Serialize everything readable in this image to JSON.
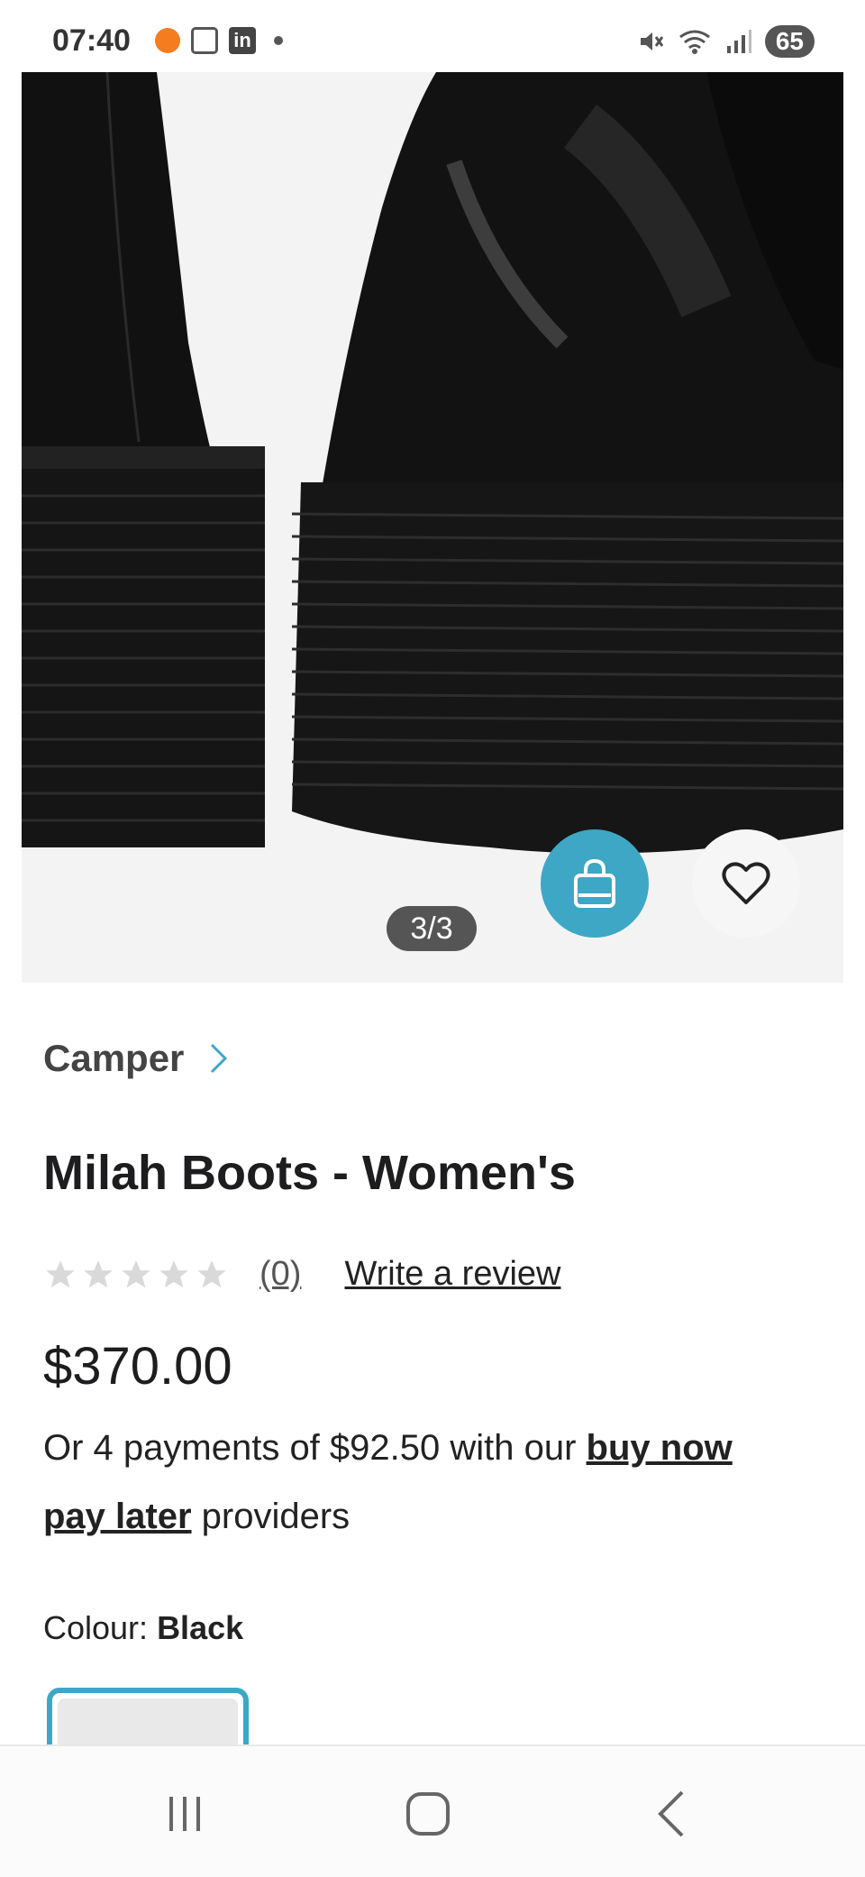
{
  "status_bar": {
    "time": "07:40",
    "battery": "65",
    "icons": [
      "notification-orange-icon",
      "screenshot-icon",
      "linkedin-icon",
      "dot-icon",
      "mute-icon",
      "wifi-icon",
      "signal-icon"
    ]
  },
  "gallery": {
    "counter": "3/3",
    "bag_icon": "shopping-bag-icon",
    "wishlist_icon": "heart-icon"
  },
  "product": {
    "brand": "Camper",
    "title": "Milah Boots - Women's",
    "rating_count": "(0)",
    "write_review": "Write a review",
    "price": "$370.00",
    "bnpl_prefix": "Or 4 payments of $92.50 with our ",
    "bnpl_link": "buy now pay later",
    "bnpl_suffix": " providers",
    "colour_label": "Colour: ",
    "colour_value": "Black"
  },
  "colors": {
    "accent": "#3ea7c6",
    "text": "#1d1d1f",
    "star_empty": "#d9d9d9"
  }
}
